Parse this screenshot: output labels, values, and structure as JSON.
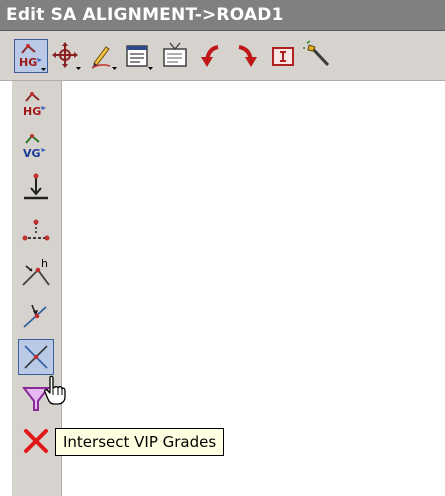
{
  "window": {
    "title": "Edit SA ALIGNMENT->ROAD1"
  },
  "toolbar": {
    "buttons": [
      {
        "icon": "hg-edit-icon",
        "active": true
      },
      {
        "icon": "move-icon"
      },
      {
        "icon": "pencil-icon"
      },
      {
        "icon": "property-sheet-icon"
      },
      {
        "icon": "tv-view-icon"
      },
      {
        "icon": "undo-arrow-icon"
      },
      {
        "icon": "redo-arrow-icon"
      },
      {
        "icon": "info-icon"
      },
      {
        "icon": "wand-icon"
      }
    ]
  },
  "dropdown": {
    "items": [
      {
        "icon": "hg-icon",
        "label": "HG"
      },
      {
        "icon": "vg-icon",
        "label": "VG"
      },
      {
        "icon": "insert-vip-icon"
      },
      {
        "icon": "delete-vip-icon"
      },
      {
        "icon": "intersect-h-icon",
        "label": "h"
      },
      {
        "icon": "intersect-point-icon"
      },
      {
        "icon": "intersect-vip-grades-icon",
        "hovered": true
      },
      {
        "icon": "filter-icon"
      },
      {
        "icon": "close-icon"
      }
    ]
  },
  "tooltip": {
    "text": "Intersect VIP Grades"
  },
  "colors": {
    "titlebar": "#808080",
    "toolbar": "#d6d3ce",
    "hover": "#b9c9e6",
    "tooltip_bg": "#ffffe1"
  }
}
